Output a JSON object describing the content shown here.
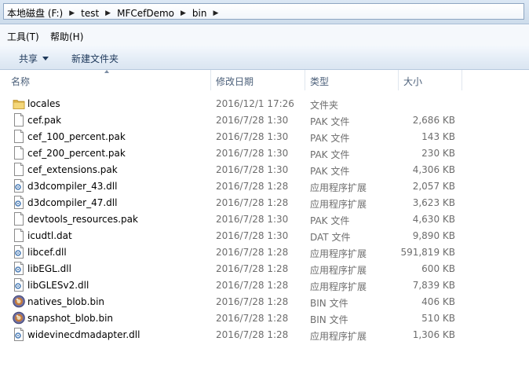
{
  "breadcrumbs": [
    "本地磁盘 (F:)",
    "test",
    "MFCefDemo",
    "bin"
  ],
  "menu": [
    "工具(T)",
    "帮助(H)"
  ],
  "toolbar": {
    "share_label": "共享",
    "new_folder_label": "新建文件夹"
  },
  "columns": {
    "name": "名称",
    "date": "修改日期",
    "type": "类型",
    "size": "大小"
  },
  "files": [
    {
      "name": "locales",
      "date": "2016/12/1 17:26",
      "type": "文件夹",
      "size": "",
      "icon": "folder-icon"
    },
    {
      "name": "cef.pak",
      "date": "2016/7/28 1:30",
      "type": "PAK 文件",
      "size": "2,686 KB",
      "icon": "file-icon"
    },
    {
      "name": "cef_100_percent.pak",
      "date": "2016/7/28 1:30",
      "type": "PAK 文件",
      "size": "143 KB",
      "icon": "file-icon"
    },
    {
      "name": "cef_200_percent.pak",
      "date": "2016/7/28 1:30",
      "type": "PAK 文件",
      "size": "230 KB",
      "icon": "file-icon"
    },
    {
      "name": "cef_extensions.pak",
      "date": "2016/7/28 1:30",
      "type": "PAK 文件",
      "size": "4,306 KB",
      "icon": "file-icon"
    },
    {
      "name": "d3dcompiler_43.dll",
      "date": "2016/7/28 1:28",
      "type": "应用程序扩展",
      "size": "2,057 KB",
      "icon": "dll-icon"
    },
    {
      "name": "d3dcompiler_47.dll",
      "date": "2016/7/28 1:28",
      "type": "应用程序扩展",
      "size": "3,623 KB",
      "icon": "dll-icon"
    },
    {
      "name": "devtools_resources.pak",
      "date": "2016/7/28 1:30",
      "type": "PAK 文件",
      "size": "4,630 KB",
      "icon": "file-icon"
    },
    {
      "name": "icudtl.dat",
      "date": "2016/7/28 1:30",
      "type": "DAT 文件",
      "size": "9,890 KB",
      "icon": "file-icon"
    },
    {
      "name": "libcef.dll",
      "date": "2016/7/28 1:28",
      "type": "应用程序扩展",
      "size": "591,819 KB",
      "icon": "dll-icon"
    },
    {
      "name": "libEGL.dll",
      "date": "2016/7/28 1:28",
      "type": "应用程序扩展",
      "size": "600 KB",
      "icon": "dll-icon"
    },
    {
      "name": "libGLESv2.dll",
      "date": "2016/7/28 1:28",
      "type": "应用程序扩展",
      "size": "7,839 KB",
      "icon": "dll-icon"
    },
    {
      "name": "natives_blob.bin",
      "date": "2016/7/28 1:28",
      "type": "BIN 文件",
      "size": "406 KB",
      "icon": "bin-icon"
    },
    {
      "name": "snapshot_blob.bin",
      "date": "2016/7/28 1:28",
      "type": "BIN 文件",
      "size": "510 KB",
      "icon": "bin-icon"
    },
    {
      "name": "widevinecdmadapter.dll",
      "date": "2016/7/28 1:28",
      "type": "应用程序扩展",
      "size": "1,306 KB",
      "icon": "dll-icon"
    }
  ]
}
